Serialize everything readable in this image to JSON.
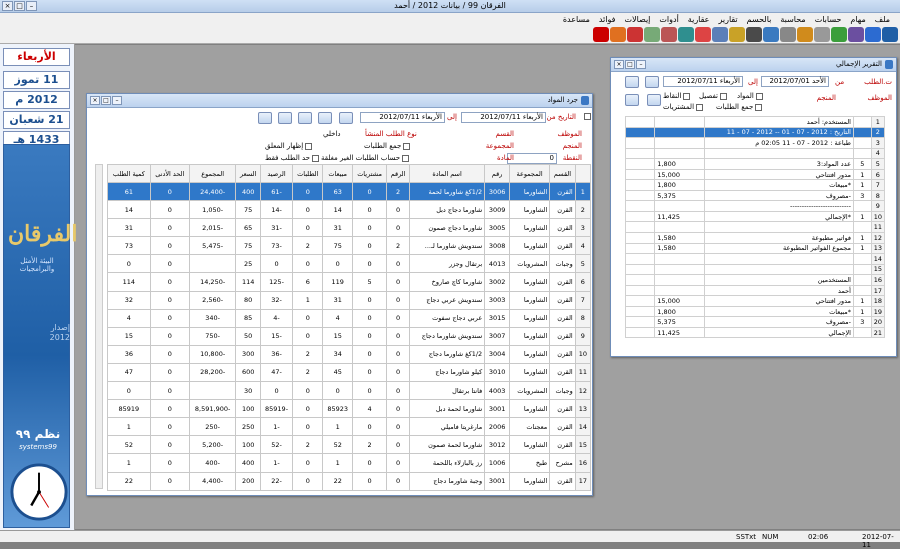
{
  "window": {
    "title": "الفرقان 99 / بيانات 2012 / أحمد"
  },
  "menu": [
    "ملف",
    "مهام",
    "حسابات",
    "محاسبة",
    "بالحسم",
    "تقارير",
    "عقارية",
    "أدوات",
    "إيصالات",
    "فوائد",
    "مساعدة"
  ],
  "left_panel": {
    "day": "الأربعاء",
    "greg_date": "11 تموز",
    "greg_year": "2012 م",
    "hijri_date": "21 شعبان",
    "hijri_year": "1433 هـ",
    "brand_logo": "الفرقان",
    "brand_sub": "البيئة الأمثل والبرامجيات",
    "version": "إصدار",
    "version_year": "2012",
    "sys_ar": "نظم ٩٩",
    "sys_en": "systems99"
  },
  "statusbar": {
    "date": "2012-07-11",
    "time": "02:06",
    "num": "NUM",
    "sst": "SSTxt"
  },
  "stock": {
    "title": "جرد المواد",
    "date_from_label": "التاريخ من",
    "date_from_day": "الأربعاء",
    "date_from": "2012/07/11",
    "to_label": "إلى",
    "date_to_day": "الأربعاء",
    "date_to": "2012/07/11",
    "employee_label": "الموظف",
    "section_label": "القسم",
    "warehouse_label": "المنجم",
    "group_label": "المجموعة",
    "bal_label": "النقطة",
    "item_label": "المادة",
    "bal_value": "0",
    "order_type_label": "نوع الطلب المنشأ",
    "order_type_value": "داخلي",
    "chk1": "جمع الطلبات",
    "chk2": "حساب الطلبات الغير مغلقة",
    "chk3": "إظهار المعلق",
    "chk4": "حد الطلب فقط",
    "columns": [
      "القسم",
      "المجموعة",
      "رقم",
      "اسم المادة",
      "الرقم",
      "مشتريات",
      "مبيعات",
      "الطلبات",
      "الرصيد",
      "السعر",
      "المجموع",
      "الحد الأدنى",
      "كمية الطلب"
    ],
    "rows": [
      [
        "القرن",
        "الشاورما",
        "3006",
        "1/2كغ شاورما لحمة",
        "2",
        "0",
        "63",
        "0",
        "-61",
        "400",
        "-24,400",
        "0",
        "61"
      ],
      [
        "القرن",
        "الشاورما",
        "3009",
        "شاورما دجاج دبل",
        "0",
        "0",
        "14",
        "0",
        "-14",
        "75",
        "-1,050",
        "0",
        "14"
      ],
      [
        "القرن",
        "الشاورما",
        "3005",
        "شاورما دجاج صمون",
        "0",
        "0",
        "31",
        "0",
        "-31",
        "65",
        "-2,015",
        "0",
        "31"
      ],
      [
        "القرن",
        "الشاورما",
        "3008",
        "سندويش شاورما لـ...",
        "2",
        "0",
        "75",
        "2",
        "-73",
        "75",
        "-5,475",
        "0",
        "73"
      ],
      [
        "وجبات",
        "المشروبات",
        "4013",
        "برتقال وجزر",
        "0",
        "0",
        "0",
        "0",
        "0",
        "25",
        "",
        "0",
        "0"
      ],
      [
        "القرن",
        "الشاورما",
        "3002",
        "شاورما كاچ صاروخ",
        "0",
        "5",
        "119",
        "6",
        "-125",
        "114",
        "-14,250",
        "0",
        "114"
      ],
      [
        "القرن",
        "الشاورما",
        "3003",
        "سندويش عربي دجاج",
        "0",
        "0",
        "31",
        "1",
        "-32",
        "80",
        "-2,560",
        "0",
        "32"
      ],
      [
        "القرن",
        "الشاورما",
        "3015",
        "عربي دجاج سفوت",
        "0",
        "0",
        "4",
        "0",
        "-4",
        "85",
        "-340",
        "0",
        "4"
      ],
      [
        "القرن",
        "الشاورما",
        "3007",
        "سندويش شاورما دجاج",
        "0",
        "0",
        "15",
        "0",
        "-15",
        "50",
        "-750",
        "0",
        "15"
      ],
      [
        "القرن",
        "الشاورما",
        "3004",
        "1/2كغ شاورما دجاج",
        "0",
        "0",
        "34",
        "2",
        "-36",
        "300",
        "-10,800",
        "0",
        "36"
      ],
      [
        "القرن",
        "الشاورما",
        "3010",
        "كيلو شاورما دجاج",
        "0",
        "0",
        "45",
        "2",
        "-47",
        "600",
        "-28,200",
        "0",
        "47"
      ],
      [
        "وجبات",
        "المشروبات",
        "4003",
        "فانتا برتقال",
        "0",
        "0",
        "0",
        "0",
        "0",
        "30",
        "",
        "0",
        "0"
      ],
      [
        "القرن",
        "الشاورما",
        "3001",
        "شاورما لحمة دبل",
        "0",
        "4",
        "85923",
        "0",
        "-85919",
        "100",
        "-8,591,900",
        "0",
        "85919"
      ],
      [
        "القرن",
        "معجنات",
        "2006",
        "مارغريتا فاميلي",
        "0",
        "0",
        "1",
        "0",
        "-1",
        "250",
        "-250",
        "0",
        "1"
      ],
      [
        "القرن",
        "الشاورما",
        "3012",
        "شاورما لحمة صمون",
        "0",
        "2",
        "52",
        "2",
        "-52",
        "100",
        "-5,200",
        "0",
        "52"
      ],
      [
        "مشرح",
        "طبخ",
        "1006",
        "رز بالبازلاء باللحمة",
        "0",
        "0",
        "1",
        "0",
        "-1",
        "400",
        "-400",
        "0",
        "1"
      ],
      [
        "القرن",
        "الشاورما",
        "3001",
        "وجبة شاورما دجاج",
        "0",
        "0",
        "22",
        "0",
        "-22",
        "200",
        "-4,400",
        "0",
        "22"
      ]
    ]
  },
  "report": {
    "title": "التقرير الإجمالي",
    "date_from_label": "ت.الطلب",
    "date_from_day": "الأحد",
    "date_from": "2012/07/01",
    "from_word": "من",
    "to_label": "إلى",
    "date_to_day": "الأربعاء",
    "date_to": "2012/07/11",
    "employee_label": "الموظف",
    "warehouse_label": "المنجم",
    "chk1": "المواد",
    "chk2": "تفصيل",
    "chk3": "النقاط",
    "chk4": "جمع الطلبات",
    "chk5": "المشتريات",
    "rows": [
      [
        "",
        "المستخدم: أحمد",
        "",
        ""
      ],
      [
        "",
        "التاريخ : 2012 - 07 - 01 -- 2012 - 07 - 11",
        "",
        ""
      ],
      [
        "",
        "طباعة : 2012 - 07 - 11  02:05 م",
        "",
        ""
      ],
      [
        "",
        "",
        "",
        ""
      ],
      [
        "5",
        "عدد المواد:3",
        "1,800",
        ""
      ],
      [
        "1",
        "مدور افتتاحي",
        "15,000",
        ""
      ],
      [
        "1",
        "*مبيعات",
        "1,800",
        ""
      ],
      [
        "3",
        "-مصروف",
        "5,375",
        ""
      ],
      [
        "",
        "--------------------------",
        "",
        ""
      ],
      [
        "1",
        "*الإجمالي",
        "11,425",
        ""
      ],
      [
        "",
        "",
        "",
        ""
      ],
      [
        "1",
        "فواتير مطبوعة",
        "1,580",
        ""
      ],
      [
        "1",
        "مجموع الفواتير المطبوعة",
        "1,580",
        ""
      ],
      [
        "",
        "",
        "",
        ""
      ],
      [
        "",
        "",
        "",
        ""
      ],
      [
        "",
        "المستخدمين",
        "",
        ""
      ],
      [
        "",
        "أحمد",
        "",
        ""
      ],
      [
        "1",
        "مدور افتتاحي",
        "15,000",
        ""
      ],
      [
        "1",
        "*مبيعات",
        "1,800",
        ""
      ],
      [
        "3",
        "-مصروف",
        "5,375",
        ""
      ],
      [
        "",
        "الإجمالي",
        "11,425",
        ""
      ]
    ]
  }
}
